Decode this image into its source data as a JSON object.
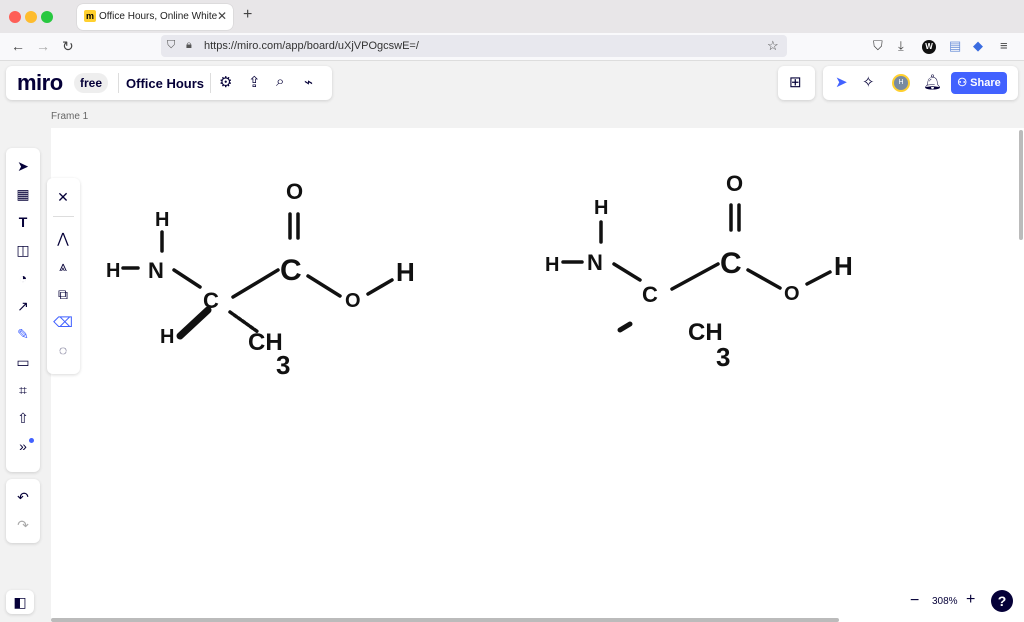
{
  "browser": {
    "tab_title": "Office Hours, Online Whiteboard",
    "url": "https://miro.com/app/board/uXjVPOgcswE=/"
  },
  "app": {
    "logo": "miro",
    "plan_badge": "free",
    "board_title": "Office Hours",
    "share_label": "Share",
    "avatar_initial": "H",
    "frame_label": "Frame 1",
    "zoom_level": "308%",
    "help_label": "?"
  },
  "drawing": {
    "left_molecule": {
      "top_O": "O",
      "carbonyl_C": "C",
      "alpha_C": "C",
      "N": "N",
      "H_on_N": "H",
      "H_left": "H",
      "O_right": "O",
      "H_right": "H",
      "H_wedge": "H",
      "CH": "CH",
      "sub3": "3"
    },
    "right_molecule": {
      "top_O": "O",
      "carbonyl_C": "C",
      "alpha_C": "C",
      "N": "N",
      "H_on_N": "H",
      "H_left": "H",
      "O_right": "O",
      "H_right": "H",
      "CH": "CH",
      "sub3": "3"
    }
  },
  "colors": {
    "brand_blue": "#4262ff",
    "ink": "#111111",
    "miro_yellow": "#ffd02f"
  }
}
